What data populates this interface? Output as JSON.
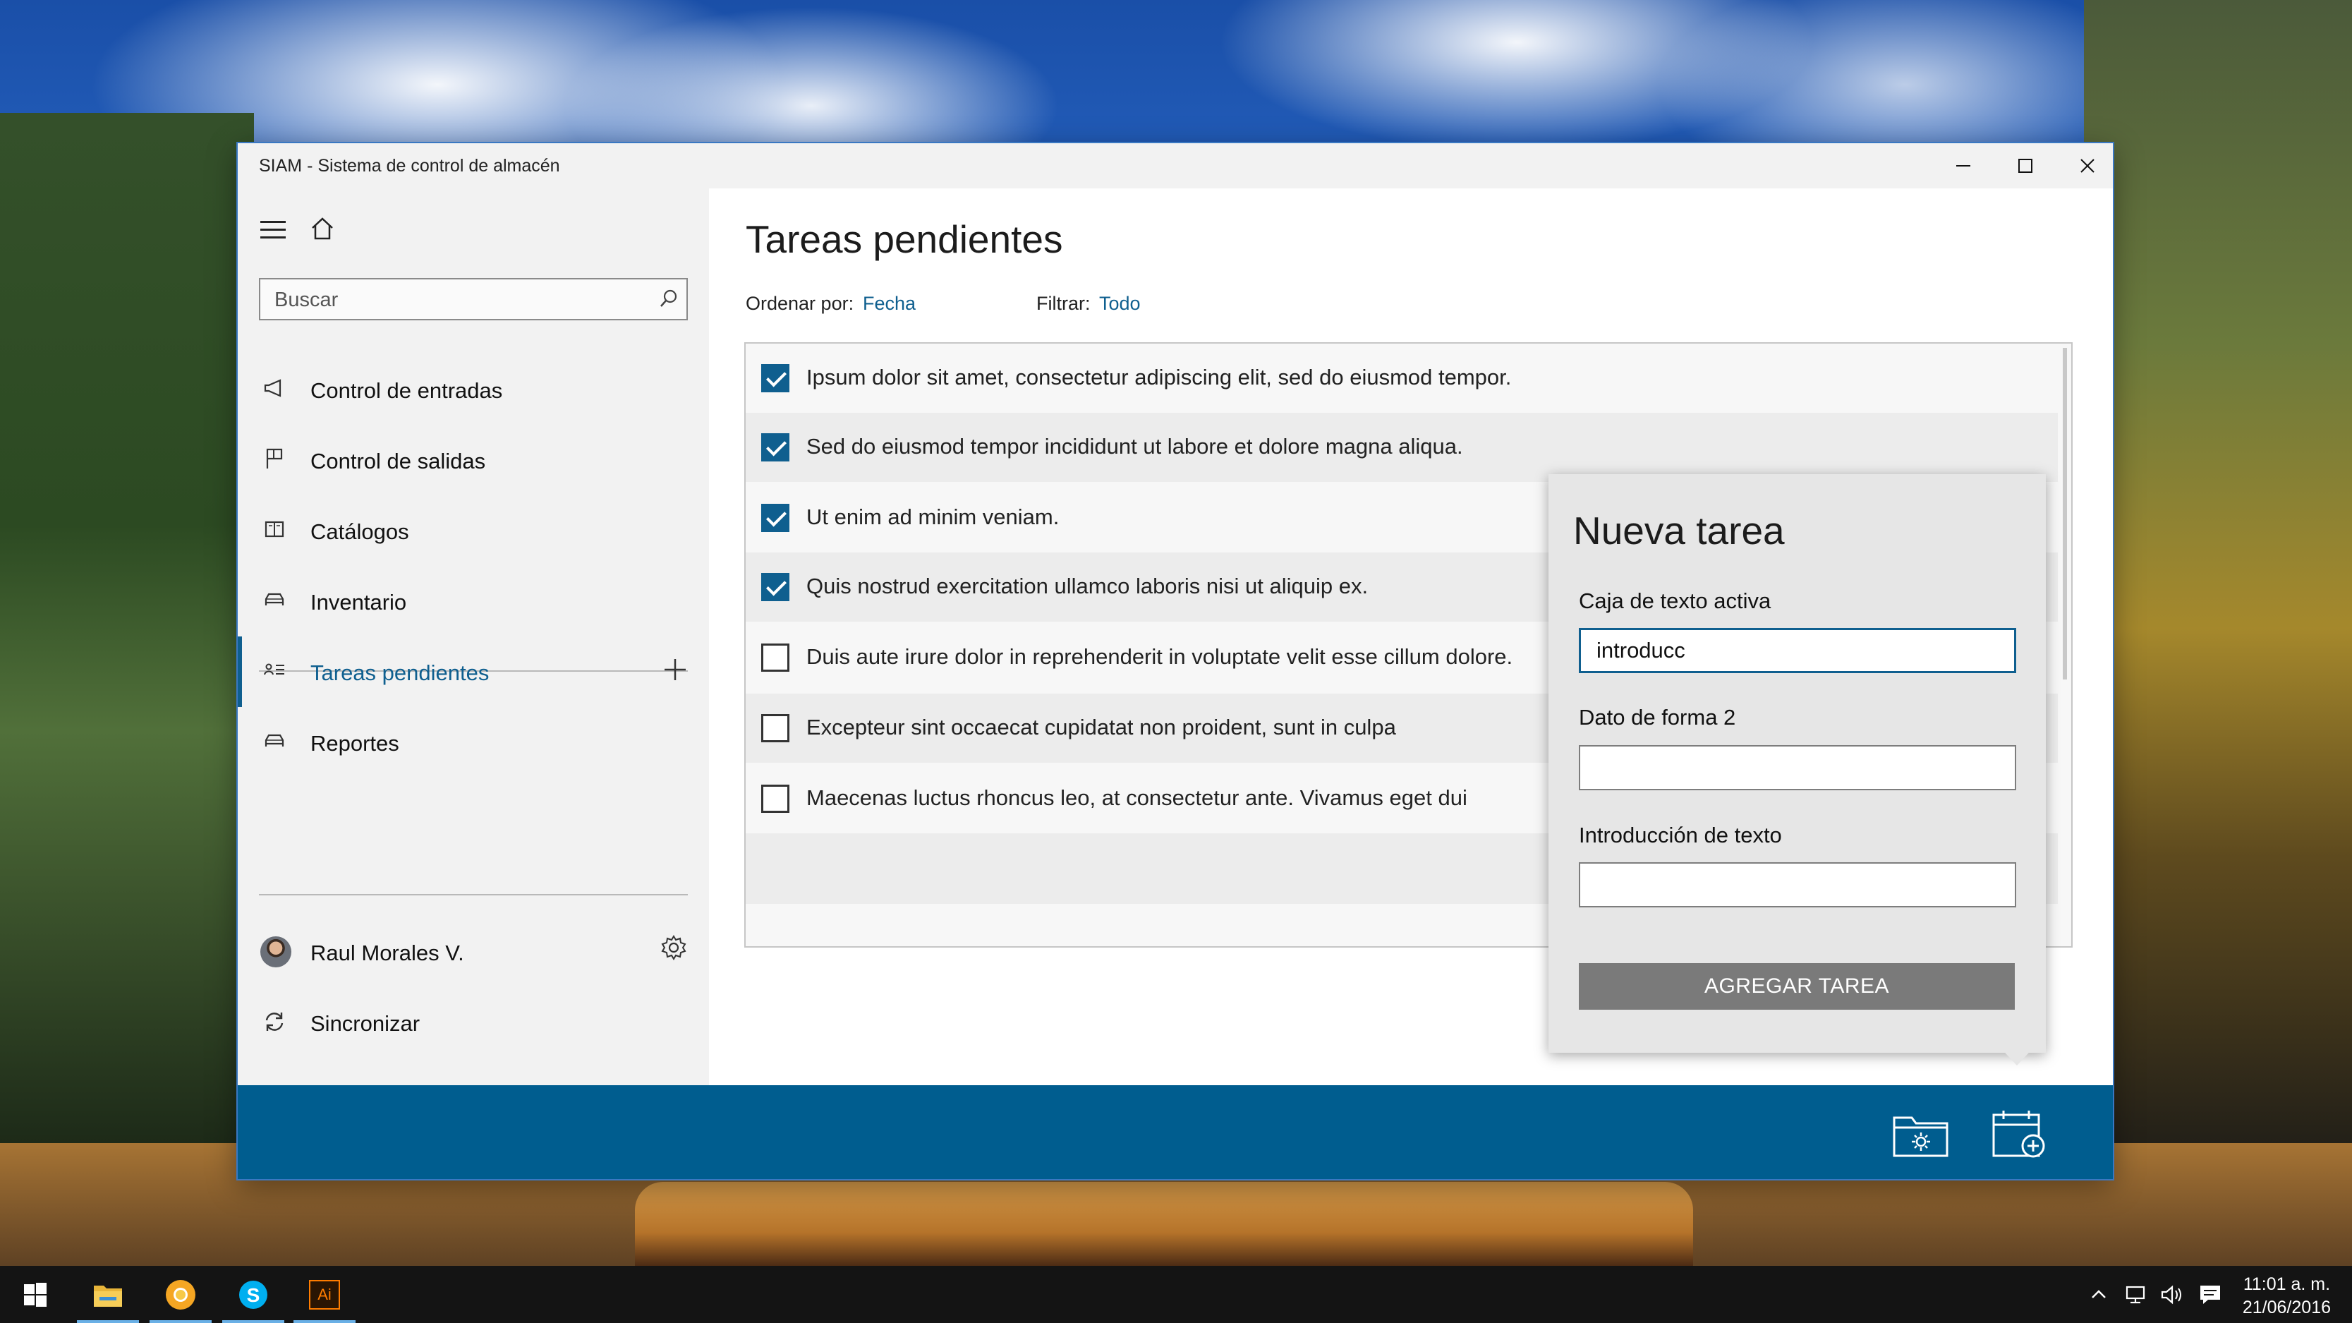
{
  "window": {
    "title": "SIAM - Sistema de control de almacén",
    "controls": [
      "minimize",
      "maximize",
      "close"
    ]
  },
  "sidebar": {
    "search_placeholder": "Buscar",
    "items": [
      {
        "label": "Control de entradas",
        "icon": "megaphone-icon"
      },
      {
        "label": "Control de salidas",
        "icon": "flag-icon"
      },
      {
        "label": "Catálogos",
        "icon": "book-icon"
      },
      {
        "label": "Inventario",
        "icon": "car-icon"
      },
      {
        "label": "Tareas pendientes",
        "icon": "task-list-icon",
        "active": true
      },
      {
        "label": "Reportes",
        "icon": "car-icon"
      }
    ],
    "user_name": "Raul Morales V.",
    "sync_label": "Sincronizar"
  },
  "main": {
    "title": "Tareas pendientes",
    "sort_label": "Ordenar por:",
    "sort_value": "Fecha",
    "filter_label": "Filtrar:",
    "filter_value": "Todo",
    "tasks": [
      {
        "text": "Ipsum dolor sit amet, consectetur adipiscing elit, sed do eiusmod tempor.",
        "checked": true
      },
      {
        "text": "Sed do eiusmod tempor incididunt ut labore et dolore magna aliqua.",
        "checked": true
      },
      {
        "text": "Ut enim ad minim veniam.",
        "checked": true
      },
      {
        "text": "Quis nostrud exercitation ullamco laboris nisi ut aliquip ex.",
        "checked": true
      },
      {
        "text": "Duis aute irure dolor in reprehenderit in voluptate velit esse cillum dolore.",
        "checked": false
      },
      {
        "text": "Excepteur sint occaecat cupidatat non proident, sunt in culpa",
        "checked": false
      },
      {
        "text": "Maecenas luctus rhoncus leo, at consectetur ante. Vivamus eget dui",
        "checked": false
      }
    ]
  },
  "flyout": {
    "title": "Nueva tarea",
    "field1_label": "Caja de texto activa",
    "field1_value": "introducc",
    "field2_label": "Dato de forma 2",
    "field2_value": "",
    "field3_label": "Introducción de texto",
    "field3_value": "",
    "button_label": "AGREGAR TAREA"
  },
  "command_bar": {
    "icons": [
      "folder-settings-icon",
      "calendar-add-icon"
    ],
    "color": "#005d8f"
  },
  "taskbar": {
    "apps": [
      "start-icon",
      "file-explorer-icon",
      "chrome-canary-icon",
      "skype-icon",
      "illustrator-icon"
    ],
    "illustrator_label": "Ai",
    "time": "11:01 a. m.",
    "date": "21/06/2016"
  },
  "colors": {
    "accent": "#0f5f8f",
    "checkbox": "#0f5f8f",
    "button": "#7a7a7a"
  }
}
